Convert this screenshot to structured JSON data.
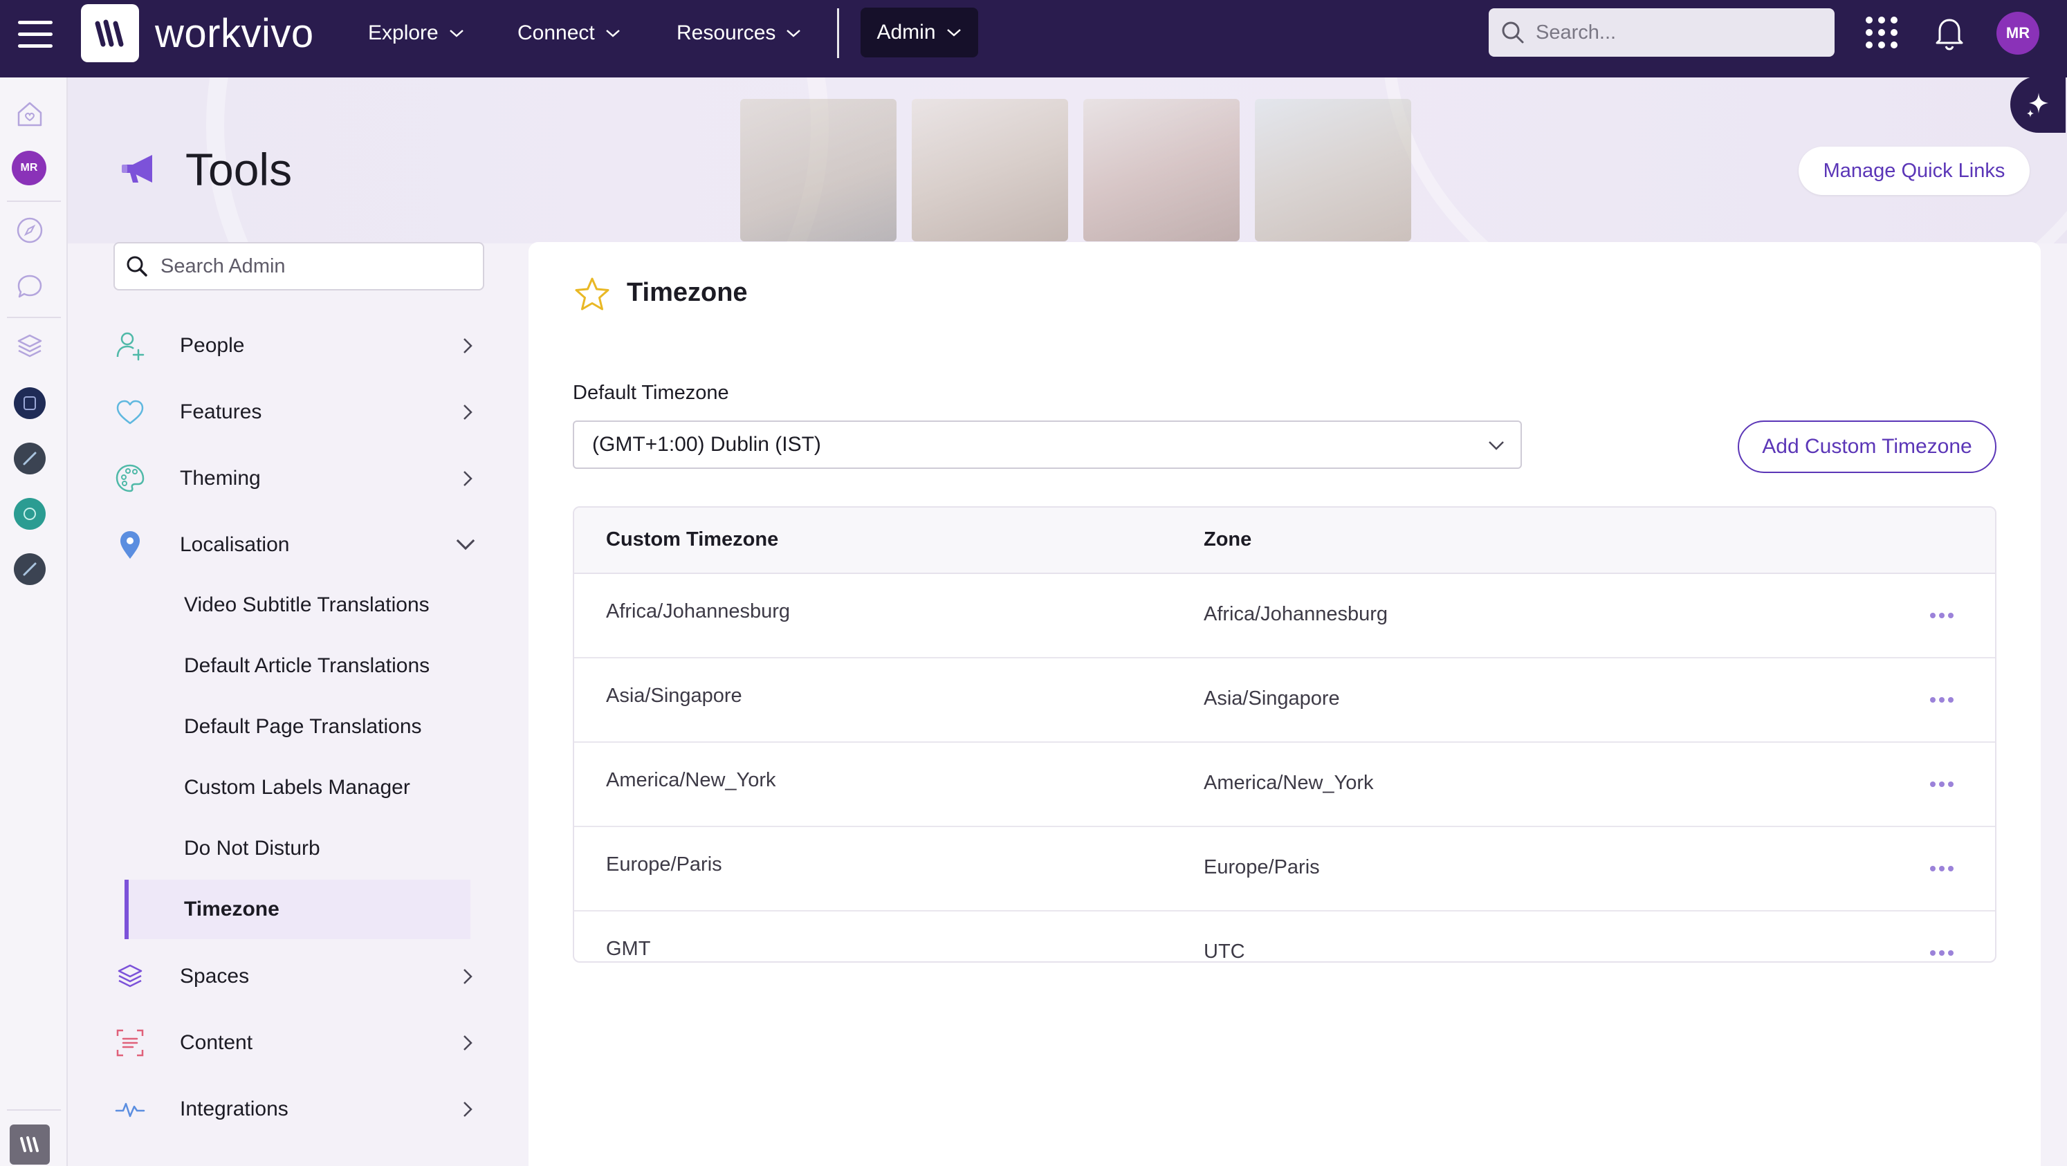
{
  "topbar": {
    "brand": "workvivo",
    "nav": [
      {
        "label": "Explore"
      },
      {
        "label": "Connect"
      },
      {
        "label": "Resources"
      }
    ],
    "admin_label": "Admin",
    "search_placeholder": "Search...",
    "avatar_initials": "MR"
  },
  "rail": {
    "avatar_initials": "MR",
    "icons": [
      "home-heart-icon",
      "compass-icon",
      "chat-icon",
      "layers-icon",
      "space-badge-icon",
      "space-badge-icon",
      "space-badge-icon",
      "space-badge-icon"
    ]
  },
  "page": {
    "title": "Tools",
    "manage_quick_links": "Manage Quick Links"
  },
  "sidebar": {
    "search_placeholder": "Search Admin",
    "items": [
      {
        "label": "People",
        "icon": "person-add-icon"
      },
      {
        "label": "Features",
        "icon": "heart-icon"
      },
      {
        "label": "Theming",
        "icon": "palette-icon"
      },
      {
        "label": "Localisation",
        "icon": "location-pin-icon",
        "expanded": true
      },
      {
        "label": "Spaces",
        "icon": "layers-icon"
      },
      {
        "label": "Content",
        "icon": "content-scan-icon"
      },
      {
        "label": "Integrations",
        "icon": "pulse-icon"
      }
    ],
    "localisation_sub": [
      {
        "label": "Video Subtitle Translations"
      },
      {
        "label": "Default Article Translations"
      },
      {
        "label": "Default Page Translations"
      },
      {
        "label": "Custom Labels Manager"
      },
      {
        "label": "Do Not Disturb"
      },
      {
        "label": "Timezone",
        "active": true
      }
    ]
  },
  "timezone": {
    "title": "Timezone",
    "default_label": "Default Timezone",
    "default_value": "(GMT+1:00) Dublin (IST)",
    "add_button": "Add Custom Timezone",
    "columns": [
      "Custom Timezone",
      "Zone"
    ],
    "rows": [
      {
        "custom": "Africa/Johannesburg",
        "zone": "Africa/Johannesburg"
      },
      {
        "custom": "Asia/Singapore",
        "zone": "Asia/Singapore"
      },
      {
        "custom": "America/New_York",
        "zone": "America/New_York"
      },
      {
        "custom": "Europe/Paris",
        "zone": "Europe/Paris"
      },
      {
        "custom": "GMT",
        "zone": "UTC"
      }
    ]
  },
  "colors": {
    "topbar": "#2a1c4e",
    "accent": "#5b36b7",
    "active_bg": "#eee8f8",
    "star": "#e9b825"
  }
}
